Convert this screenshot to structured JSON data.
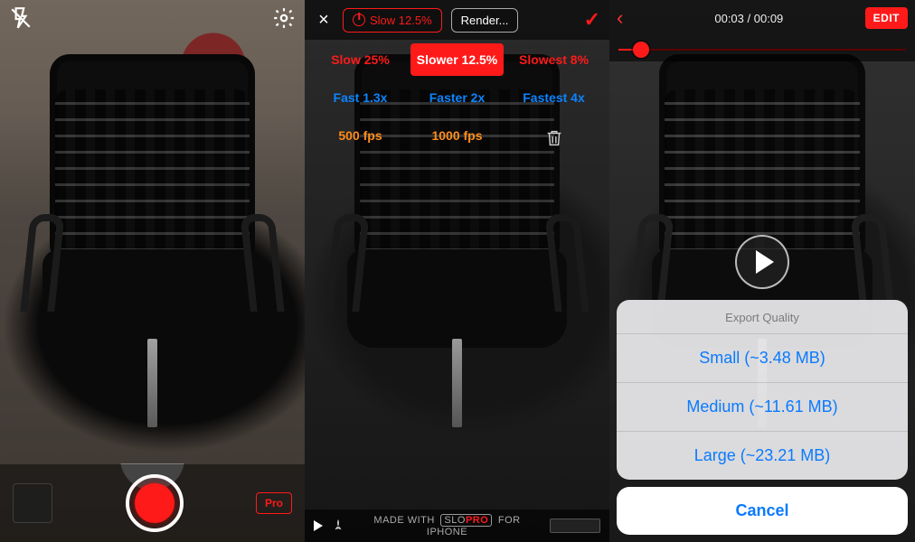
{
  "panel1": {
    "flash_icon": "flash-off",
    "settings_icon": "gear",
    "pro_label": "Pro"
  },
  "panel2": {
    "close_icon": "×",
    "speed_button": "Slow 12.5%",
    "render_button": "Render...",
    "confirm_icon": "✓",
    "grid": {
      "slow25": "Slow 25%",
      "slower125": "Slower 12.5%",
      "slowest8": "Slowest 8%",
      "fast13": "Fast 1.3x",
      "faster2": "Faster 2x",
      "fastest4": "Fastest 4x",
      "fps500": "500 fps",
      "fps1000": "1000 fps",
      "trash_icon": "trash"
    },
    "footer": {
      "play_icon": "play",
      "made_prefix": "MADE WITH",
      "brand_a": "SLO",
      "brand_b": "PRO",
      "made_suffix": "FOR IPHONE"
    }
  },
  "panel3": {
    "back_icon": "‹",
    "time_current": "00:03",
    "time_sep": " / ",
    "time_total": "00:09",
    "edit_label": "EDIT",
    "progress_fraction": 0.08,
    "play_icon": "play",
    "sheet": {
      "title": "Export Quality",
      "small": "Small (~3.48 MB)",
      "medium": "Medium (~11.61 MB)",
      "large": "Large (~23.21 MB)",
      "cancel": "Cancel"
    }
  }
}
